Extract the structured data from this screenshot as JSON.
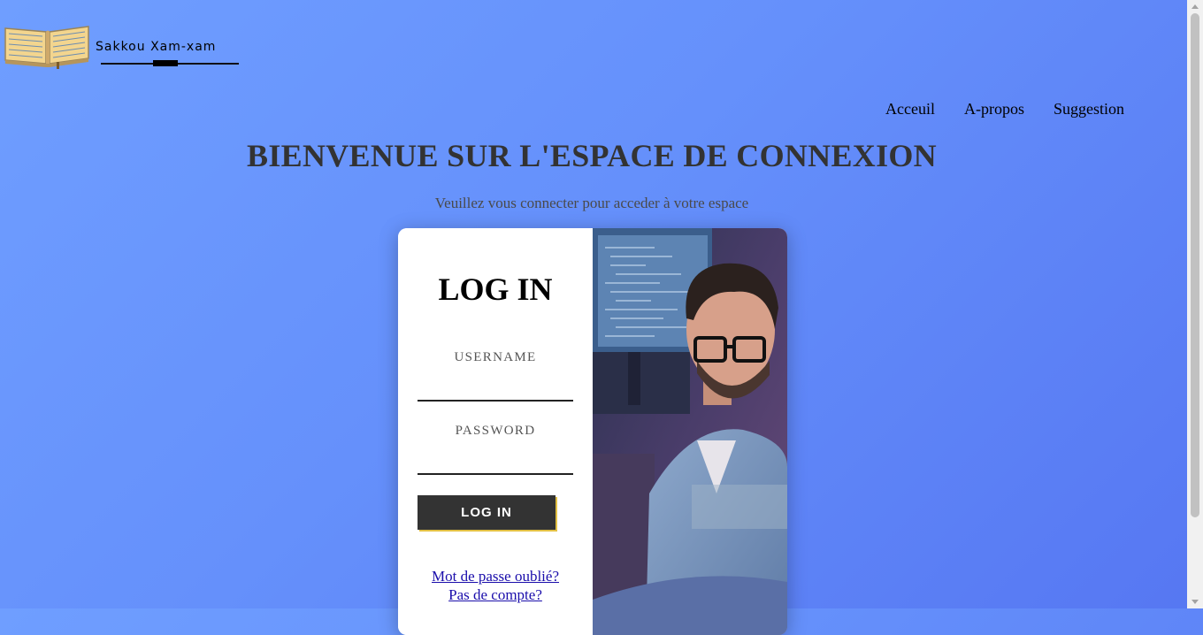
{
  "brand": {
    "name": "Sakkou Xam-xam",
    "logo_icon": "open-book-icon"
  },
  "nav": {
    "items": [
      "Acceuil",
      "A-propos",
      "Suggestion"
    ]
  },
  "header": {
    "title": "BIENVENUE SUR L'ESPACE DE CONNEXION",
    "subtitle": "Veuillez vous connecter pour acceder à votre espace"
  },
  "login": {
    "title": "LOG IN",
    "username_label": "USERNAME",
    "username_value": "",
    "password_label": "PASSWORD",
    "password_value": "",
    "submit_label": "LOG IN",
    "forgot_link": "Mot de passe oublié?",
    "signup_link": "Pas de compte?"
  },
  "colors": {
    "background_start": "#6f9eff",
    "background_end": "#5677f2",
    "button_bg": "#333333",
    "button_accent": "#e2c044",
    "link": "#1a0dab"
  }
}
